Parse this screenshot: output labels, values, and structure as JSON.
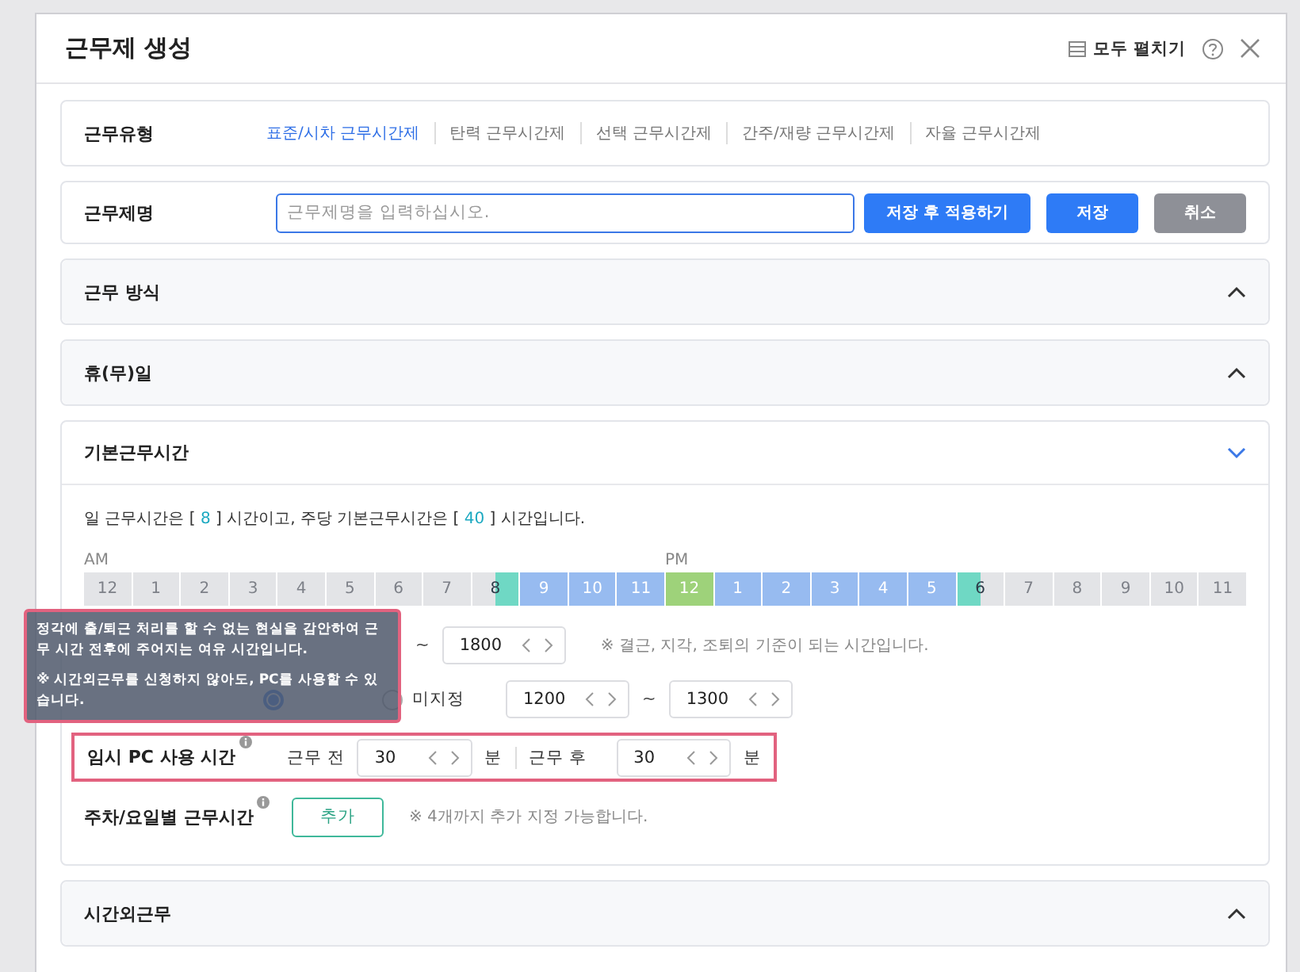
{
  "dialog": {
    "title": "근무제 생성",
    "expand_all": "모두 펼치기"
  },
  "work_type": {
    "label": "근무유형",
    "tabs": [
      {
        "label": "표준/시차 근무시간제",
        "selected": true
      },
      {
        "label": "탄력 근무시간제",
        "selected": false
      },
      {
        "label": "선택 근무시간제",
        "selected": false
      },
      {
        "label": "간주/재량 근무시간제",
        "selected": false
      },
      {
        "label": "자율 근무시간제",
        "selected": false
      }
    ]
  },
  "work_name": {
    "label": "근무제명",
    "placeholder": "근무제명을 입력하십시오.",
    "buttons": [
      {
        "label": "저장 후 적용하기",
        "kind": "primary"
      },
      {
        "label": "저장",
        "kind": "primary"
      },
      {
        "label": "취소",
        "kind": "secondary"
      }
    ]
  },
  "sections_top": [
    {
      "title": "근무 방식",
      "expanded": false
    },
    {
      "title": "휴(무)일",
      "expanded": false
    }
  ],
  "basic": {
    "title": "기본근무시간",
    "expanded": true,
    "summary_parts": [
      "일 근무시간은 [ ",
      "8",
      " ] 시간이고, 주당 기본근무시간은 [ ",
      "40",
      " ] 시간입니다."
    ],
    "am": "AM",
    "pm": "PM",
    "hours": [
      {
        "label": "12",
        "kind": "off"
      },
      {
        "label": "1",
        "kind": "off"
      },
      {
        "label": "2",
        "kind": "off"
      },
      {
        "label": "3",
        "kind": "off"
      },
      {
        "label": "4",
        "kind": "off"
      },
      {
        "label": "5",
        "kind": "off"
      },
      {
        "label": "6",
        "kind": "off"
      },
      {
        "label": "7",
        "kind": "off"
      },
      {
        "label": "8",
        "kind": "start"
      },
      {
        "label": "9",
        "kind": "work"
      },
      {
        "label": "10",
        "kind": "work"
      },
      {
        "label": "11",
        "kind": "work"
      },
      {
        "label": "12",
        "kind": "break"
      },
      {
        "label": "1",
        "kind": "work"
      },
      {
        "label": "2",
        "kind": "work"
      },
      {
        "label": "3",
        "kind": "work"
      },
      {
        "label": "4",
        "kind": "work"
      },
      {
        "label": "5",
        "kind": "work"
      },
      {
        "label": "6",
        "kind": "end"
      },
      {
        "label": "7",
        "kind": "off"
      },
      {
        "label": "8",
        "kind": "off"
      },
      {
        "label": "9",
        "kind": "off"
      },
      {
        "label": "10",
        "kind": "off"
      },
      {
        "label": "11",
        "kind": "off"
      }
    ],
    "work_time": {
      "separator": "~",
      "to": "1800",
      "note": "※ 결근, 지각, 조퇴의 기준이 되는 시간입니다."
    },
    "break_time": {
      "options": [
        {
          "selected": true
        },
        {
          "label": "미지정",
          "selected": false
        }
      ],
      "from": "1200",
      "separator": "~",
      "to": "1300"
    },
    "pc_time": {
      "label": "임시 PC 사용 시간",
      "before_label": "근무 전",
      "before": "30",
      "before_unit": "분",
      "after_label": "근무 후",
      "after": "30",
      "after_unit": "분"
    },
    "weekly": {
      "label": "주차/요일별 근무시간",
      "button": "추가",
      "note": "※ 4개까지 추가 지정 가능합니다."
    },
    "tooltip": {
      "lines": [
        "정각에 출/퇴근 처리를 할 수 없는 현실을 감안하여 근무 시간 전후에 주어지는 여유 시간입니다.",
        "※ 시간외근무를 신청하지 않아도, PC를 사용할 수 있습니다."
      ]
    }
  },
  "sections_bottom": [
    {
      "title": "시간외근무",
      "expanded": false
    }
  ]
}
